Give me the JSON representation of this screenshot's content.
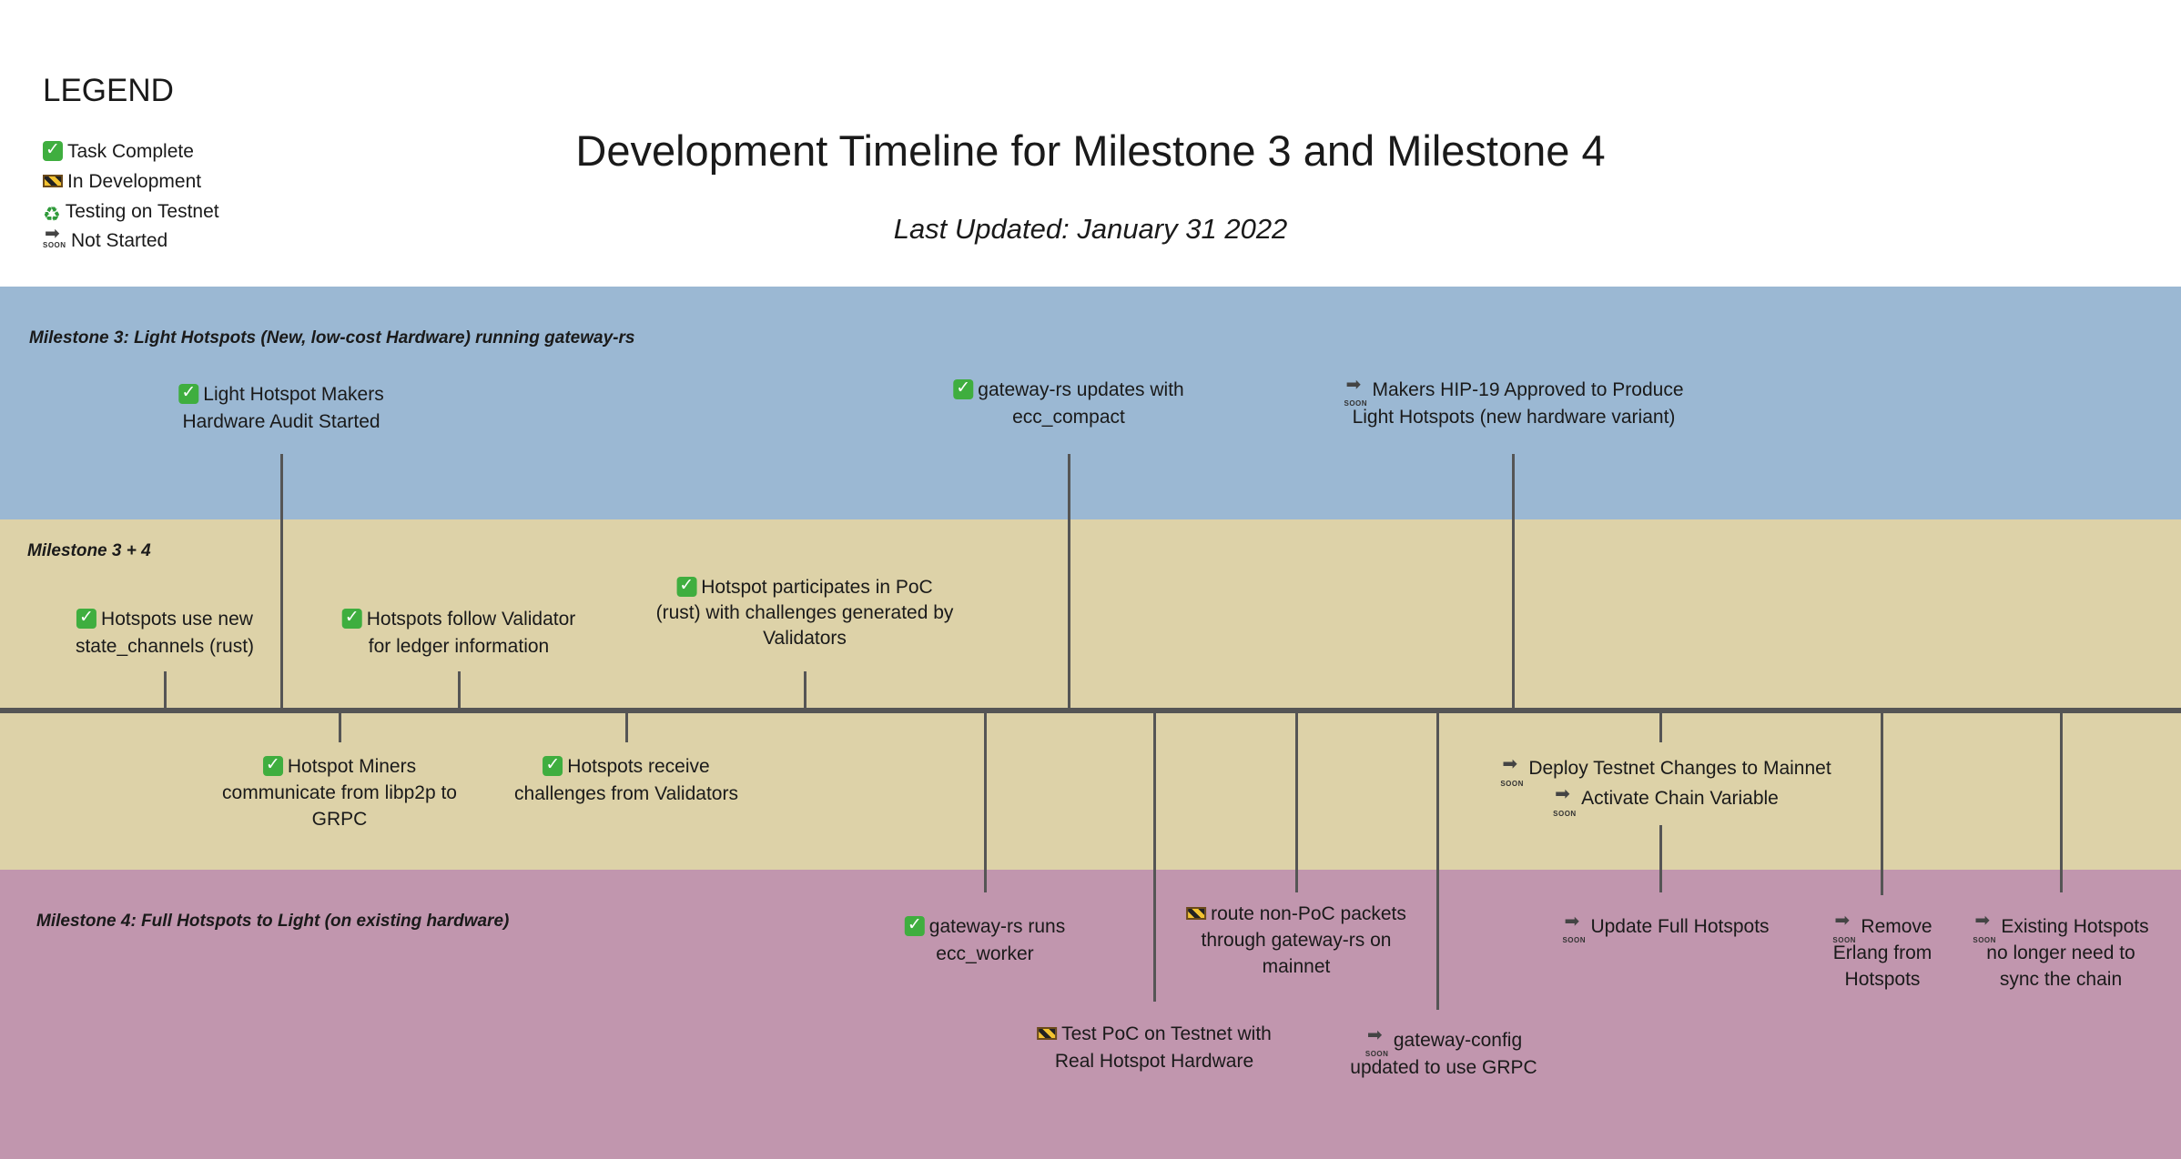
{
  "legend": {
    "title": "LEGEND",
    "items": [
      {
        "icon": "check-icon",
        "label": "Task Complete"
      },
      {
        "icon": "construction-icon",
        "label": "In Development"
      },
      {
        "icon": "recycle-icon",
        "label": "Testing on Testnet"
      },
      {
        "icon": "soon-arrow-icon",
        "label": "Not Started"
      }
    ]
  },
  "header": {
    "title": "Development Timeline for Milestone 3 and Milestone 4",
    "subtitle": "Last Updated: January 31 2022"
  },
  "bands": {
    "m3": {
      "label": "Milestone 3: Light Hotspots (New, low-cost Hardware) running gateway-rs",
      "color": "#9bb8d3"
    },
    "m34": {
      "label": "Milestone 3 + 4",
      "color": "#ddd2a8"
    },
    "m4": {
      "label": "Milestone 4: Full Hotspots to Light (on existing hardware)",
      "color": "#c196ae"
    }
  },
  "items": [
    {
      "status": "complete",
      "line1": "Light Hotspot Makers",
      "line2": "Hardware Audit Started"
    },
    {
      "status": "complete",
      "line1": "gateway-rs updates with",
      "line2": "ecc_compact"
    },
    {
      "status": "not_started",
      "line1": "Makers HIP-19 Approved to Produce",
      "line2": "Light Hotspots (new hardware variant)"
    },
    {
      "status": "complete",
      "line1": "Hotspots use new",
      "line2": "state_channels (rust)"
    },
    {
      "status": "complete",
      "line1": "Hotspots follow Validator",
      "line2": "for ledger information"
    },
    {
      "status": "complete",
      "line1": "Hotspot participates in PoC",
      "line2": "(rust) with challenges generated by",
      "line3": "Validators"
    },
    {
      "status": "complete",
      "line1": "Hotspot Miners",
      "line2": "communicate from libp2p to",
      "line3": "GRPC"
    },
    {
      "status": "complete",
      "line1": "Hotspots receive",
      "line2": "challenges from Validators"
    },
    {
      "status": "not_started",
      "line1": "Deploy Testnet Changes to Mainnet"
    },
    {
      "status": "not_started",
      "line1": "Activate Chain Variable"
    },
    {
      "status": "complete",
      "line1": "gateway-rs runs",
      "line2": "ecc_worker"
    },
    {
      "status": "in_development",
      "line1": "route non-PoC packets",
      "line2": "through gateway-rs on",
      "line3": "mainnet"
    },
    {
      "status": "in_development",
      "line1": "Test PoC on Testnet with",
      "line2": "Real Hotspot Hardware"
    },
    {
      "status": "not_started",
      "line1": "gateway-config",
      "line2": "updated to use GRPC"
    },
    {
      "status": "not_started",
      "line1": "Update Full Hotspots"
    },
    {
      "status": "not_started",
      "line1": "Remove",
      "line2": "Erlang from",
      "line3": "Hotspots"
    },
    {
      "status": "not_started",
      "line1": "Existing Hotspots",
      "line2": "no longer need to",
      "line3": "sync the chain"
    }
  ]
}
